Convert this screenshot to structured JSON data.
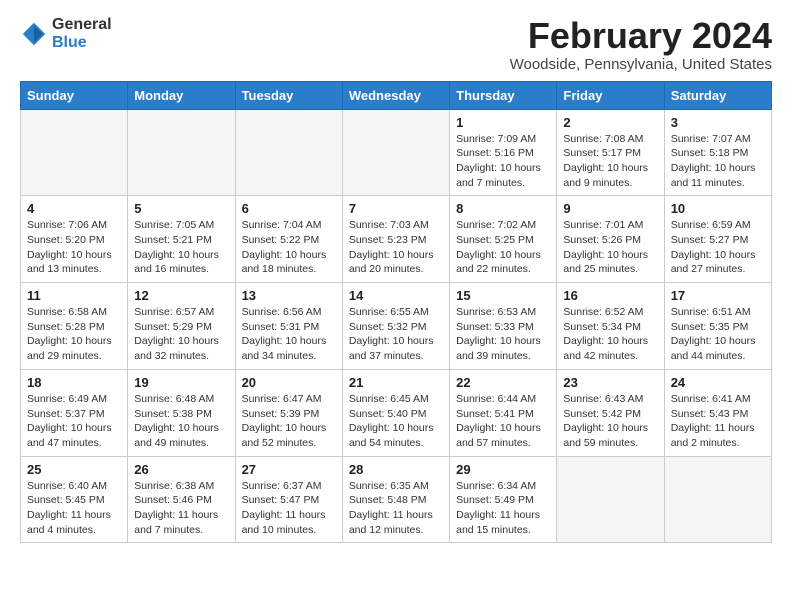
{
  "logo": {
    "general": "General",
    "blue": "Blue"
  },
  "header": {
    "month": "February 2024",
    "location": "Woodside, Pennsylvania, United States"
  },
  "weekdays": [
    "Sunday",
    "Monday",
    "Tuesday",
    "Wednesday",
    "Thursday",
    "Friday",
    "Saturday"
  ],
  "weeks": [
    [
      {
        "day": "",
        "info": ""
      },
      {
        "day": "",
        "info": ""
      },
      {
        "day": "",
        "info": ""
      },
      {
        "day": "",
        "info": ""
      },
      {
        "day": "1",
        "info": "Sunrise: 7:09 AM\nSunset: 5:16 PM\nDaylight: 10 hours\nand 7 minutes."
      },
      {
        "day": "2",
        "info": "Sunrise: 7:08 AM\nSunset: 5:17 PM\nDaylight: 10 hours\nand 9 minutes."
      },
      {
        "day": "3",
        "info": "Sunrise: 7:07 AM\nSunset: 5:18 PM\nDaylight: 10 hours\nand 11 minutes."
      }
    ],
    [
      {
        "day": "4",
        "info": "Sunrise: 7:06 AM\nSunset: 5:20 PM\nDaylight: 10 hours\nand 13 minutes."
      },
      {
        "day": "5",
        "info": "Sunrise: 7:05 AM\nSunset: 5:21 PM\nDaylight: 10 hours\nand 16 minutes."
      },
      {
        "day": "6",
        "info": "Sunrise: 7:04 AM\nSunset: 5:22 PM\nDaylight: 10 hours\nand 18 minutes."
      },
      {
        "day": "7",
        "info": "Sunrise: 7:03 AM\nSunset: 5:23 PM\nDaylight: 10 hours\nand 20 minutes."
      },
      {
        "day": "8",
        "info": "Sunrise: 7:02 AM\nSunset: 5:25 PM\nDaylight: 10 hours\nand 22 minutes."
      },
      {
        "day": "9",
        "info": "Sunrise: 7:01 AM\nSunset: 5:26 PM\nDaylight: 10 hours\nand 25 minutes."
      },
      {
        "day": "10",
        "info": "Sunrise: 6:59 AM\nSunset: 5:27 PM\nDaylight: 10 hours\nand 27 minutes."
      }
    ],
    [
      {
        "day": "11",
        "info": "Sunrise: 6:58 AM\nSunset: 5:28 PM\nDaylight: 10 hours\nand 29 minutes."
      },
      {
        "day": "12",
        "info": "Sunrise: 6:57 AM\nSunset: 5:29 PM\nDaylight: 10 hours\nand 32 minutes."
      },
      {
        "day": "13",
        "info": "Sunrise: 6:56 AM\nSunset: 5:31 PM\nDaylight: 10 hours\nand 34 minutes."
      },
      {
        "day": "14",
        "info": "Sunrise: 6:55 AM\nSunset: 5:32 PM\nDaylight: 10 hours\nand 37 minutes."
      },
      {
        "day": "15",
        "info": "Sunrise: 6:53 AM\nSunset: 5:33 PM\nDaylight: 10 hours\nand 39 minutes."
      },
      {
        "day": "16",
        "info": "Sunrise: 6:52 AM\nSunset: 5:34 PM\nDaylight: 10 hours\nand 42 minutes."
      },
      {
        "day": "17",
        "info": "Sunrise: 6:51 AM\nSunset: 5:35 PM\nDaylight: 10 hours\nand 44 minutes."
      }
    ],
    [
      {
        "day": "18",
        "info": "Sunrise: 6:49 AM\nSunset: 5:37 PM\nDaylight: 10 hours\nand 47 minutes."
      },
      {
        "day": "19",
        "info": "Sunrise: 6:48 AM\nSunset: 5:38 PM\nDaylight: 10 hours\nand 49 minutes."
      },
      {
        "day": "20",
        "info": "Sunrise: 6:47 AM\nSunset: 5:39 PM\nDaylight: 10 hours\nand 52 minutes."
      },
      {
        "day": "21",
        "info": "Sunrise: 6:45 AM\nSunset: 5:40 PM\nDaylight: 10 hours\nand 54 minutes."
      },
      {
        "day": "22",
        "info": "Sunrise: 6:44 AM\nSunset: 5:41 PM\nDaylight: 10 hours\nand 57 minutes."
      },
      {
        "day": "23",
        "info": "Sunrise: 6:43 AM\nSunset: 5:42 PM\nDaylight: 10 hours\nand 59 minutes."
      },
      {
        "day": "24",
        "info": "Sunrise: 6:41 AM\nSunset: 5:43 PM\nDaylight: 11 hours\nand 2 minutes."
      }
    ],
    [
      {
        "day": "25",
        "info": "Sunrise: 6:40 AM\nSunset: 5:45 PM\nDaylight: 11 hours\nand 4 minutes."
      },
      {
        "day": "26",
        "info": "Sunrise: 6:38 AM\nSunset: 5:46 PM\nDaylight: 11 hours\nand 7 minutes."
      },
      {
        "day": "27",
        "info": "Sunrise: 6:37 AM\nSunset: 5:47 PM\nDaylight: 11 hours\nand 10 minutes."
      },
      {
        "day": "28",
        "info": "Sunrise: 6:35 AM\nSunset: 5:48 PM\nDaylight: 11 hours\nand 12 minutes."
      },
      {
        "day": "29",
        "info": "Sunrise: 6:34 AM\nSunset: 5:49 PM\nDaylight: 11 hours\nand 15 minutes."
      },
      {
        "day": "",
        "info": ""
      },
      {
        "day": "",
        "info": ""
      }
    ]
  ]
}
